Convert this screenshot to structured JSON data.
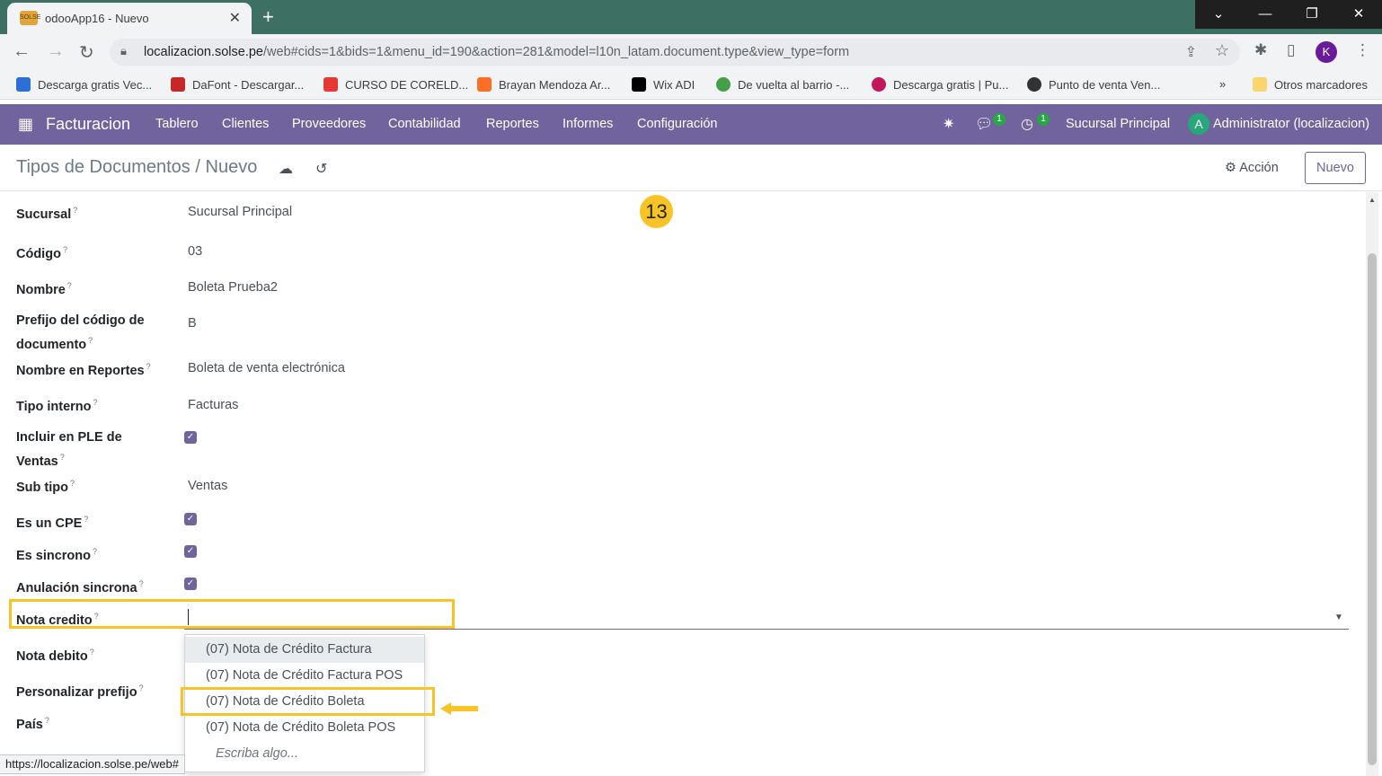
{
  "browser": {
    "tab_title": "odooApp16 - Nuevo",
    "tab_favicon_text": "SOLSE",
    "url_host": "localizacion.solse.pe",
    "url_path": "/web#cids=1&bids=1&menu_id=190&action=281&model=l10n_latam.document.type&view_type=form",
    "profile_initial": "K",
    "bookmarks": [
      {
        "label": "Descarga gratis Vec...",
        "color": "#2c6fd6"
      },
      {
        "label": "DaFont - Descargar...",
        "color": "#c62828"
      },
      {
        "label": "CURSO DE CORELD...",
        "color": "#e53935"
      },
      {
        "label": "Brayan Mendoza Ar...",
        "color": "#fc6d26"
      },
      {
        "label": "Wix ADI",
        "color": "#000000"
      },
      {
        "label": "De vuelta al barrio -...",
        "color": "#43a047"
      },
      {
        "label": "Descarga gratis | Pu...",
        "color": "#c2185b"
      },
      {
        "label": "Punto de venta Ven...",
        "color": "#333333"
      }
    ],
    "bookmarks_more": "»",
    "bookmarks_other": "Otros marcadores",
    "status_url": "https://localizacion.solse.pe/web#"
  },
  "navbar": {
    "app_name": "Facturacion",
    "menu": [
      "Tablero",
      "Clientes",
      "Proveedores",
      "Contabilidad",
      "Reportes",
      "Informes",
      "Configuración"
    ],
    "messages_count": "1",
    "activities_count": "1",
    "branch": "Sucursal Principal",
    "user_initial": "A",
    "user": "Administrator (localizacion)"
  },
  "control_panel": {
    "breadcrumb_parent": "Tipos de Documentos",
    "breadcrumb_separator": "/",
    "breadcrumb_current": "Nuevo",
    "action_label": "Acción",
    "new_button": "Nuevo"
  },
  "form": {
    "sucursal": {
      "label": "Sucursal",
      "value": "Sucursal Principal"
    },
    "codigo": {
      "label": "Código",
      "value": "03"
    },
    "nombre": {
      "label": "Nombre",
      "value": "Boleta Prueba2"
    },
    "prefijo": {
      "label_line1": "Prefijo del código de",
      "label_line2": "documento",
      "value": "B"
    },
    "nombre_reportes": {
      "label": "Nombre en Reportes",
      "value": "Boleta de venta electrónica"
    },
    "tipo_interno": {
      "label": "Tipo interno",
      "value": "Facturas"
    },
    "incluir_ple": {
      "label_line1": "Incluir en PLE de",
      "label_line2": "Ventas",
      "checked": true
    },
    "sub_tipo": {
      "label": "Sub tipo",
      "value": "Ventas"
    },
    "es_cpe": {
      "label": "Es un CPE",
      "checked": true
    },
    "es_sincrono": {
      "label": "Es sincrono",
      "checked": true
    },
    "anulacion_sincrona": {
      "label": "Anulación sincrona",
      "checked": true
    },
    "nota_credito": {
      "label": "Nota credito",
      "value": ""
    },
    "nota_debito": {
      "label": "Nota debito"
    },
    "personalizar_prefijo": {
      "label": "Personalizar prefijo"
    },
    "pais": {
      "label": "País"
    },
    "help_marker": "?"
  },
  "dropdown": {
    "options": [
      "(07) Nota de Crédito Factura",
      "(07) Nota de Crédito Factura POS",
      "(07) Nota de Crédito Boleta",
      "(07) Nota de Crédito Boleta POS"
    ],
    "hint": "Escriba algo..."
  },
  "step_number": "13",
  "colors": {
    "odoo_primary": "#71639e",
    "highlight": "#f7c325",
    "tab_strip": "#3d7062"
  }
}
